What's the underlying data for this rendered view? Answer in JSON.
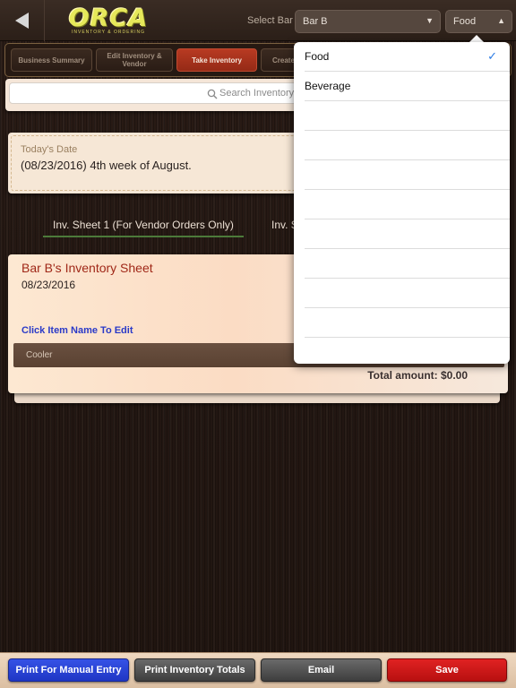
{
  "header": {
    "logo_text": "ORCA",
    "logo_subtitle": "INVENTORY & ORDERING",
    "select_bar_label": "Select Bar",
    "bar_value": "Bar B",
    "type_value": "Food"
  },
  "nav": {
    "tabs": [
      {
        "label": "Business Summary",
        "active": false
      },
      {
        "label": "Edit Inventory & Vendor",
        "active": false
      },
      {
        "label": "Take Inventory",
        "active": true
      },
      {
        "label": "Create",
        "active": false
      }
    ]
  },
  "search": {
    "placeholder": "Search Inventory It"
  },
  "date_card": {
    "label": "Today's Date",
    "value": "(08/23/2016) 4th week of August."
  },
  "sheet_tabs": [
    {
      "label": "Inv. Sheet 1 (For Vendor Orders Only)",
      "active": true
    },
    {
      "label": "Inv. S",
      "active": false
    }
  ],
  "inventory_sheet": {
    "title": "Bar B's Inventory Sheet",
    "date": "08/23/2016",
    "hint": "Click Item Name To Edit",
    "section": "Cooler",
    "total": "Total amount: $0.00"
  },
  "dropdown": {
    "options": [
      {
        "label": "Food",
        "selected": true
      },
      {
        "label": "Beverage",
        "selected": false
      }
    ],
    "check_glyph": "✓"
  },
  "bottom": {
    "print_manual": "Print For Manual Entry",
    "print_totals": "Print Inventory Totals",
    "email": "Email",
    "save": "Save"
  }
}
